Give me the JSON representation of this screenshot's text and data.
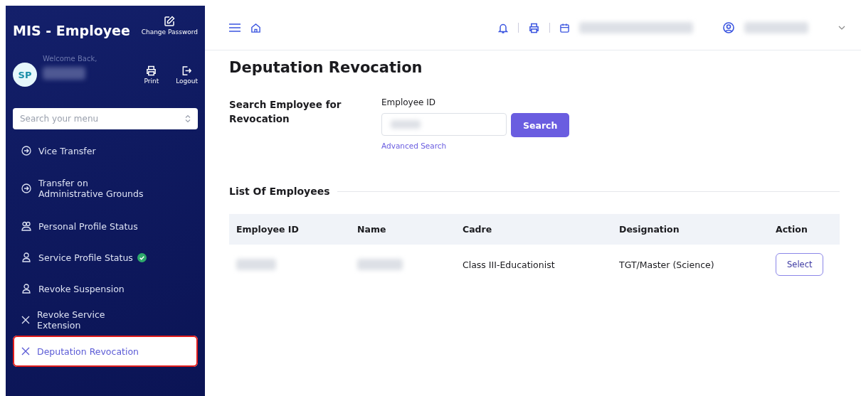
{
  "sidebar": {
    "app_title": "MIS - Employee",
    "change_password": "Change Password",
    "avatar_initials": "SP",
    "welcome": "Welcome Back,",
    "print": "Print",
    "logout": "Logout",
    "search": {
      "placeholder": "Search your menu"
    },
    "items": [
      {
        "label": "Vice Transfer",
        "kind": "arrow",
        "verified": false,
        "selected": false,
        "highlighted": false
      },
      {
        "label": "Transfer on Administrative Grounds",
        "kind": "arrow",
        "verified": false,
        "selected": false,
        "highlighted": false
      },
      {
        "label": "Personal Profile Status",
        "kind": "people",
        "verified": false,
        "selected": false,
        "highlighted": false
      },
      {
        "label": "Service Profile Status",
        "kind": "person",
        "verified": true,
        "selected": false,
        "highlighted": false
      },
      {
        "label": "Revoke Suspension",
        "kind": "person",
        "verified": false,
        "selected": false,
        "highlighted": false
      },
      {
        "label": "Revoke Service Extension",
        "kind": "cross",
        "verified": false,
        "selected": false,
        "highlighted": false
      },
      {
        "label": "Deputation Revocation",
        "kind": "cross",
        "verified": false,
        "selected": true,
        "highlighted": true
      }
    ]
  },
  "page_title": "Deputation Revocation",
  "search_section": {
    "heading": "Search Employee for Revocation",
    "field_label": "Employee ID",
    "button": "Search",
    "advanced_link": "Advanced Search"
  },
  "list_heading": "List Of Employees",
  "table": {
    "columns": [
      "Employee ID",
      "Name",
      "Cadre",
      "Designation",
      "Action"
    ],
    "rows": [
      {
        "cadre": "Class III-Educationist",
        "designation": "TGT/Master (Science)",
        "action": "Select"
      }
    ]
  }
}
